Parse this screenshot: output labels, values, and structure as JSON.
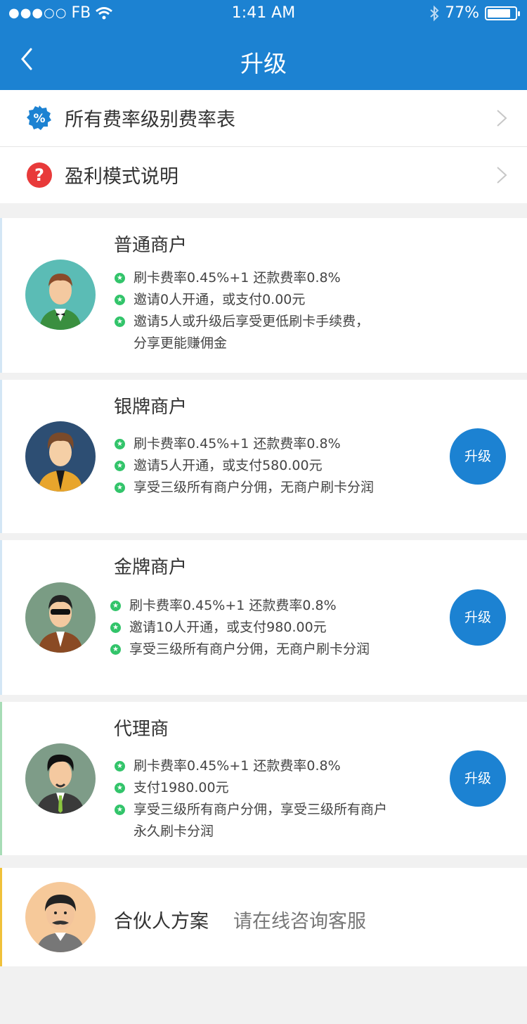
{
  "status_bar": {
    "signal": "●●●○○",
    "carrier": "FB",
    "time": "1:41 AM",
    "battery": "77%"
  },
  "nav": {
    "title": "升级"
  },
  "menu": {
    "rate_table": "所有费率级别费率表",
    "profit_mode": "盈利模式说明"
  },
  "cards": [
    {
      "name": "普通商户",
      "items": [
        "刷卡费率0.45%+1   还款费率0.8%",
        "邀请0人开通，或支付0.00元",
        "邀请5人或升级后享受更低刷卡手续费，",
        "分享更能赚佣金"
      ]
    },
    {
      "name": "银牌商户",
      "items": [
        "刷卡费率0.45%+1   还款费率0.8%",
        "邀请5人开通，或支付580.00元",
        "享受三级所有商户分佣，无商户刷卡分润"
      ],
      "button": "升级"
    },
    {
      "name": "金牌商户",
      "items": [
        "刷卡费率0.45%+1   还款费率0.8%",
        "邀请10人开通，或支付980.00元",
        "享受三级所有商户分佣，无商户刷卡分润"
      ],
      "button": "升级"
    },
    {
      "name": "代理商",
      "items": [
        "刷卡费率0.45%+1   还款费率0.8%",
        "支付1980.00元",
        "享受三级所有商户分佣，享受三级所有商户",
        "永久刷卡分润"
      ],
      "button": "升级"
    }
  ],
  "partner": {
    "title": "合伙人方案",
    "hint": "请在线咨询客服"
  },
  "colors": {
    "primary": "#1c82d2",
    "star": "#32c46a",
    "background": "#f1f1f1"
  }
}
